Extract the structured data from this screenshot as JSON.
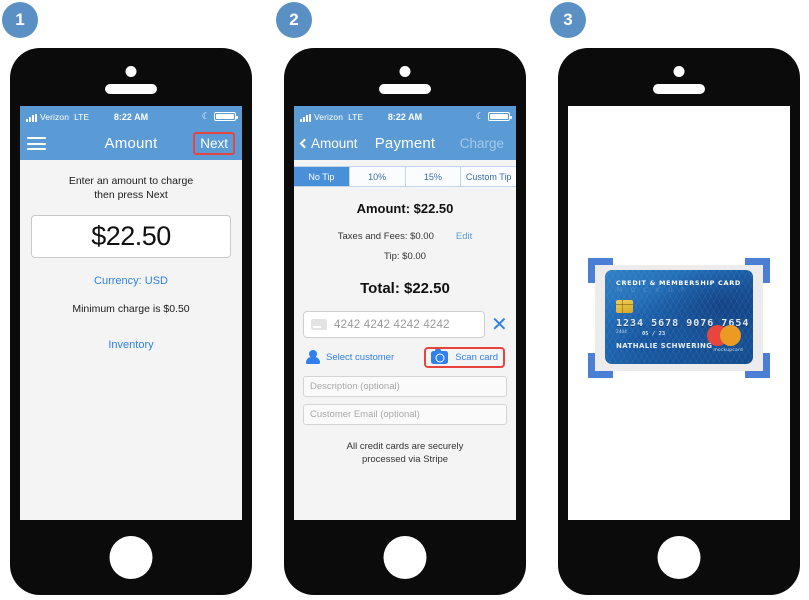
{
  "steps": [
    {
      "number": "1"
    },
    {
      "number": "2"
    },
    {
      "number": "3"
    }
  ],
  "status_bar": {
    "carrier": "Verizon",
    "network": "LTE",
    "time": "8:22 AM",
    "moon_icon": "☾"
  },
  "screen1": {
    "nav": {
      "menu_icon": "hamburger-icon",
      "title": "Amount",
      "next_label": "Next"
    },
    "hint_line1": "Enter an amount to charge",
    "hint_line2": "then press Next",
    "amount_value": "$22.50",
    "currency_label": "Currency: USD",
    "minimum_label": "Minimum charge is $0.50",
    "inventory_label": "Inventory"
  },
  "screen2": {
    "nav": {
      "back_label": "Amount",
      "title": "Payment",
      "charge_label": "Charge"
    },
    "tip_tabs": [
      {
        "label": "No Tip",
        "selected": true
      },
      {
        "label": "10%",
        "selected": false
      },
      {
        "label": "15%",
        "selected": false
      },
      {
        "label": "Custom Tip",
        "selected": false
      }
    ],
    "amount_label": "Amount: $22.50",
    "taxes_label": "Taxes and Fees: $0.00",
    "edit_label": "Edit",
    "tip_label": "Tip: $0.00",
    "total_label": "Total: $22.50",
    "card_placeholder": "4242 4242 4242 4242",
    "clear_icon": "✕",
    "select_customer_label": "Select customer",
    "scan_card_label": "Scan card",
    "description_placeholder": "Description (optional)",
    "email_placeholder": "Customer Email (optional)",
    "stripe_note_line1": "All credit cards are securely",
    "stripe_note_line2": "processed via Stripe"
  },
  "screen3": {
    "card": {
      "title": "CREDIT & MEMBERSHIP CARD",
      "watermark": "M O C K U P",
      "number": "1234 5678 9076 7654",
      "small_number": "2444",
      "expiry": "05 / 23",
      "holder": "NATHALIE SCHWERING",
      "brand_text": "mockupcard"
    }
  },
  "colors": {
    "header_blue": "#5b9bd5",
    "accent_blue": "#2f80ed",
    "highlight_red": "#e8443f",
    "badge_blue": "#5b90c4",
    "bracket_blue": "#4a7fd4"
  }
}
